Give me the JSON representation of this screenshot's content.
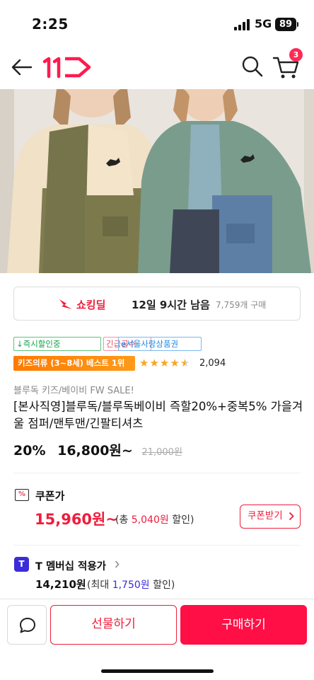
{
  "status": {
    "time": "2:25",
    "network": "5G",
    "battery": "89"
  },
  "header": {
    "cart_count": "3"
  },
  "deal": {
    "label": "쇼킹딜",
    "time_left": "12일 9시간 남음",
    "purchases": "7,759개 구매"
  },
  "tags": {
    "instant": "↓즉시할인중",
    "urgent": "긴급공수",
    "seoul": "e서울사랑상품권"
  },
  "best": {
    "label": "키즈의류 (3~8세) 베스트 1위",
    "stars": 4.5,
    "review_count": "2,094"
  },
  "product": {
    "brand_line": "블루독 키즈/베이비 FW SALE!",
    "title": "[본사직영]블루독/블루독베이비 즉할20%+중복5% 가을겨울 점퍼/맨투맨/긴팔티셔츠",
    "discount": "20%",
    "price": "16,800원~",
    "original_price": "21,000원"
  },
  "coupon": {
    "icon": "%",
    "label": "쿠폰가",
    "price": "15,960원~",
    "note_prefix": "(총 ",
    "note_amount": "5,040원",
    "note_suffix": " 할인)",
    "button": "쿠폰받기"
  },
  "tmember": {
    "icon": "T",
    "label": "T 멤버십 적용가",
    "price": "14,210원",
    "note_prefix": "(최대 ",
    "note_amount": "1,750원",
    "note_suffix": " 할인)"
  },
  "actions": {
    "gift": "선물하기",
    "buy": "구매하기"
  },
  "colors": {
    "accent": "#ef1d3c",
    "buy": "#ff0f45",
    "tmember": "#3b2bd8",
    "best": "#ff8a00"
  }
}
